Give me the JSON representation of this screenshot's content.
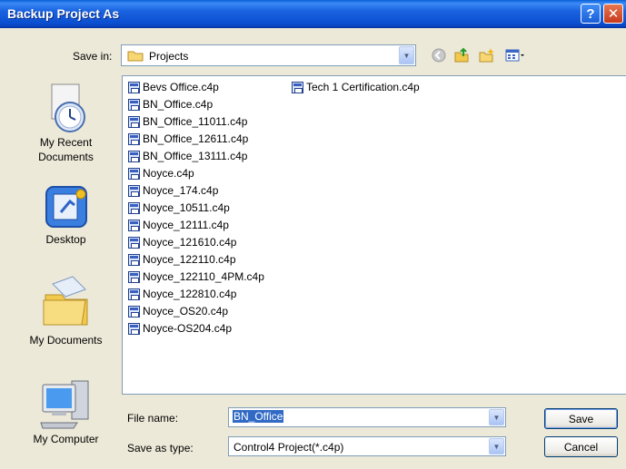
{
  "window": {
    "title": "Backup Project As",
    "help_icon": "question-mark-icon",
    "close_icon": "close-icon"
  },
  "toolbar": {
    "save_in_label": "Save in:",
    "save_in_value": "Projects",
    "icons": [
      "back-icon",
      "up-folder-icon",
      "new-folder-icon",
      "views-menu-icon"
    ]
  },
  "places": [
    {
      "label": "My Recent Documents",
      "icon": "recent-documents-icon"
    },
    {
      "label": "Desktop",
      "icon": "desktop-icon"
    },
    {
      "label": "My Documents",
      "icon": "my-documents-icon"
    },
    {
      "label": "My Computer",
      "icon": "my-computer-icon"
    }
  ],
  "files": [
    "Bevs Office.c4p",
    "BN_Office.c4p",
    "BN_Office_11011.c4p",
    "BN_Office_12611.c4p",
    "BN_Office_13111.c4p",
    "Noyce.c4p",
    "Noyce_174.c4p",
    "Noyce_10511.c4p",
    "Noyce_12111.c4p",
    "Noyce_121610.c4p",
    "Noyce_122110.c4p",
    "Noyce_122110_4PM.c4p",
    "Noyce_122810.c4p",
    "Noyce_OS20.c4p",
    "Noyce-OS204.c4p",
    "Tech 1 Certification.c4p"
  ],
  "form": {
    "file_name_label": "File name:",
    "file_name_value": "BN_Office",
    "save_type_label": "Save as type:",
    "save_type_value": "Control4 Project(*.c4p)",
    "save_button": "Save",
    "cancel_button": "Cancel"
  },
  "colors": {
    "titlebar": "#0b4fd1",
    "selection": "#316ac5",
    "dialog_bg": "#ece9d8"
  }
}
